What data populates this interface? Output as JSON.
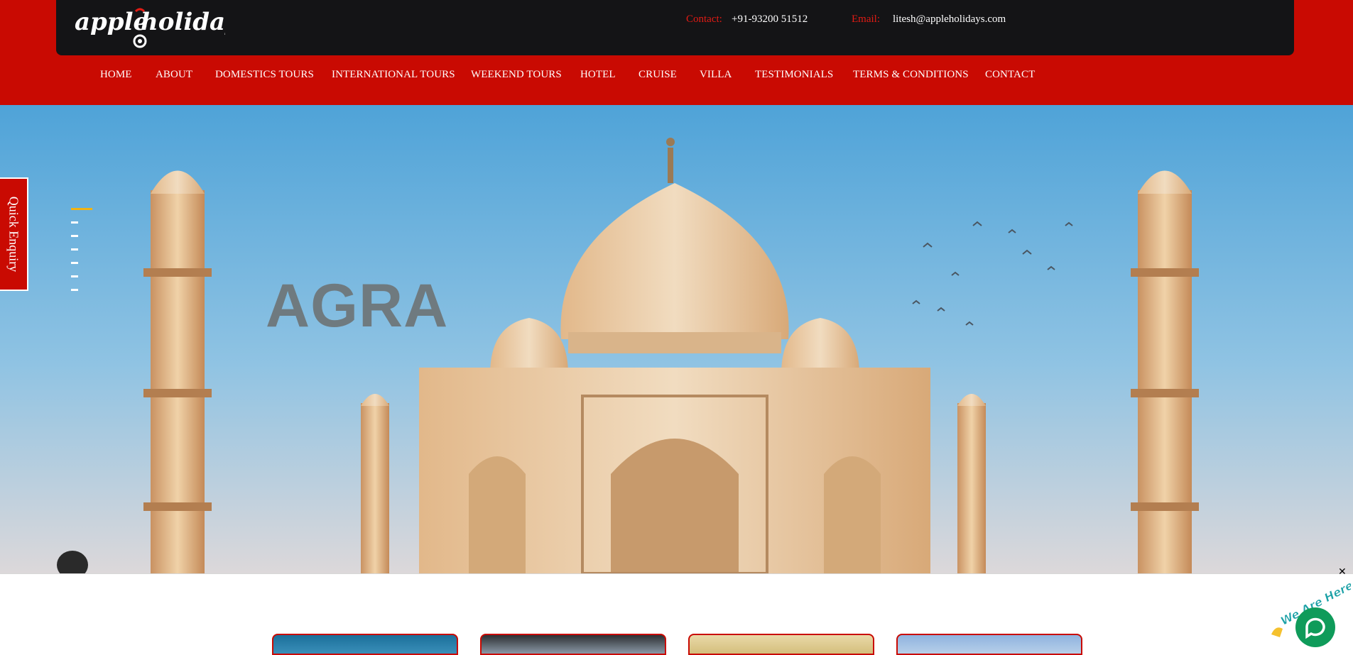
{
  "header": {
    "logo_text": "appleholidays",
    "contact_label": "Contact:",
    "contact_value": "+91-93200 51512",
    "email_label": "Email:",
    "email_value": "litesh@appleholidays.com",
    "brand_color": "#c90a02"
  },
  "nav": {
    "items": [
      {
        "label": "HOME"
      },
      {
        "label": "ABOUT"
      },
      {
        "label": "DOMESTICS TOURS"
      },
      {
        "label": "INTERNATIONAL TOURS"
      },
      {
        "label": "WEEKEND TOURS"
      },
      {
        "label": "HOTEL"
      },
      {
        "label": "CRUISE"
      },
      {
        "label": "VILLA"
      },
      {
        "label": "TESTIMONIALS"
      },
      {
        "label": "TERMS & CONDITIONS"
      },
      {
        "label": "CONTACT"
      }
    ]
  },
  "hero": {
    "title": "AGRA",
    "slide_count": 7,
    "active_slide": 1
  },
  "quick_enquiry": {
    "label": "Quick Enquiry"
  },
  "chat_widget": {
    "badge_text": "We Are Here!",
    "close_symbol": "✕"
  }
}
